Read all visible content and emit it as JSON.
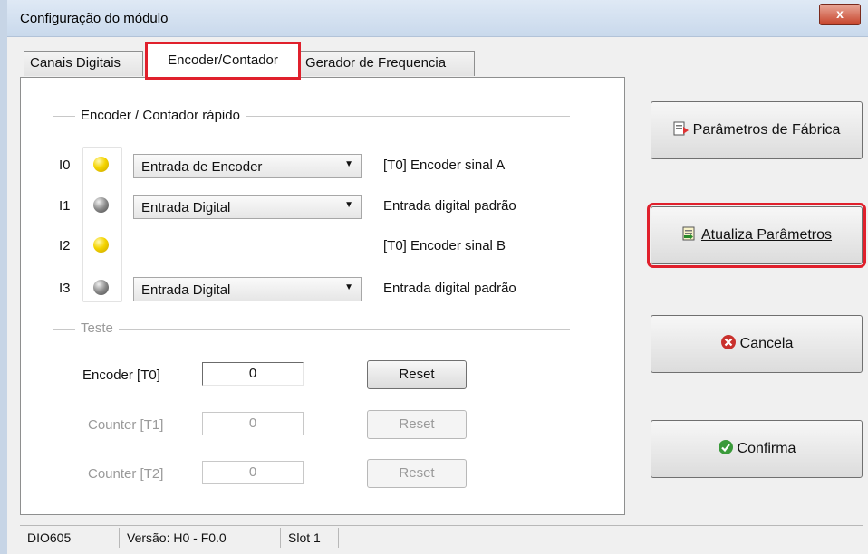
{
  "window": {
    "title": "Configuração do módulo",
    "close_label": "x"
  },
  "tabs": [
    {
      "label": "Canais Digitais"
    },
    {
      "label": "Encoder/Contador"
    },
    {
      "label": "Gerador de Frequencia"
    }
  ],
  "encoder_group": {
    "label": "Encoder / Contador rápido",
    "rows": [
      {
        "id": "I0",
        "led": "yellow",
        "select": "Entrada de Encoder",
        "desc": "[T0] Encoder sinal A"
      },
      {
        "id": "I1",
        "led": "gray",
        "select": "Entrada Digital",
        "desc": "Entrada digital padrão"
      },
      {
        "id": "I2",
        "led": "yellow",
        "select": "",
        "desc": "[T0] Encoder sinal B"
      },
      {
        "id": "I3",
        "led": "gray",
        "select": "Entrada Digital",
        "desc": "Entrada digital padrão"
      }
    ]
  },
  "test_group": {
    "label": "Teste",
    "rows": [
      {
        "label": "Encoder [T0]",
        "value": "0",
        "button": "Reset",
        "enabled": true
      },
      {
        "label": "Counter [T1]",
        "value": "0",
        "button": "Reset",
        "enabled": false
      },
      {
        "label": "Counter [T2]",
        "value": "0",
        "button": "Reset",
        "enabled": false
      }
    ]
  },
  "side_buttons": {
    "factory": "Parâmetros de Fábrica",
    "update": "Atualiza Parâmetros",
    "cancel": "Cancela",
    "confirm": "Confirma"
  },
  "status": {
    "model": "DIO605",
    "version": "Versão: H0 - F0.0",
    "slot": "Slot 1"
  },
  "colors": {
    "highlight": "#e0202c",
    "led_on": "#f4d400",
    "led_off": "#808080"
  }
}
